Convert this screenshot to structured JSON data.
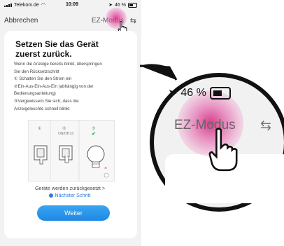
{
  "status_bar": {
    "carrier": "Telekom.de",
    "time": "10:09",
    "battery": "46 %"
  },
  "nav": {
    "cancel": "Abbrechen",
    "mode": "EZ-Modus",
    "swap_icon": "swap-arrows-icon"
  },
  "card": {
    "title_line1": "Setzen Sie das Gerät",
    "title_line2": "zuerst zurück.",
    "body": [
      "Wenn die Anzeige bereits blinkt, überspringen",
      "Sie den Rücksetzschritt",
      "① Schalten Sie den Strom ein",
      "②Ein-Aus-Ein-Aus-Ein (abhängig von der",
      "Bedienungsanleitung)",
      "③Vergewissern Sie sich, dass die",
      "Anzeigeleuchte schnell blinkt"
    ],
    "steps": [
      "①",
      "②",
      "③"
    ],
    "step2_caption": "ON/Off x3",
    "reset_link": "Geräte werden zurückgesetzt >",
    "next_step": "Nächster Schritt",
    "continue_button": "Weiter"
  },
  "zoom": {
    "battery": "46 %",
    "mode": "EZ-Modus"
  },
  "colors": {
    "accent": "#1e88e5",
    "tap": "#d81b7a",
    "check": "#2bb54a"
  }
}
